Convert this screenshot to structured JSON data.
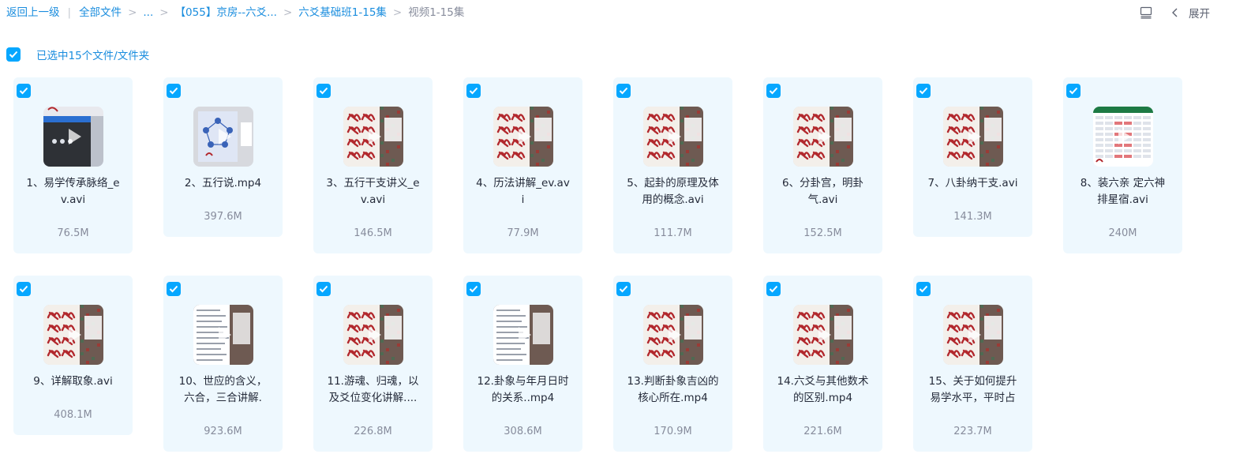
{
  "breadcrumb": {
    "back": "返回上一级",
    "root": "全部文件",
    "ellipsis": "...",
    "folder1": "【055】京房--六爻...",
    "folder2": "六爻基础班1-15集",
    "current": "视频1-15集"
  },
  "toolbar": {
    "expand_label": "展开"
  },
  "selection": {
    "text": "已选中15个文件/文件夹"
  },
  "colors": {
    "accent": "#06a7ff",
    "link": "#1a8dde",
    "card_bg": "#eef8fe"
  },
  "files": [
    {
      "name_lines": [
        "1、易学传承脉络_e",
        "v.avi"
      ],
      "size": "76.5M",
      "thumb": "player"
    },
    {
      "name_lines": [
        "2、五行说.mp4"
      ],
      "size": "397.6M",
      "thumb": "diagram"
    },
    {
      "name_lines": [
        "3、五行干支讲义_e",
        "v.avi"
      ],
      "size": "146.5M",
      "thumb": "calligraphy"
    },
    {
      "name_lines": [
        "4、历法讲解_ev.av",
        "i"
      ],
      "size": "77.9M",
      "thumb": "calligraphy"
    },
    {
      "name_lines": [
        "5、起卦的原理及体",
        "用的概念.avi"
      ],
      "size": "111.7M",
      "thumb": "calligraphy"
    },
    {
      "name_lines": [
        "6、分卦宫，明卦",
        "气.avi"
      ],
      "size": "152.5M",
      "thumb": "calligraphy"
    },
    {
      "name_lines": [
        "7、八卦纳干支.avi"
      ],
      "size": "141.3M",
      "thumb": "calligraphy"
    },
    {
      "name_lines": [
        "8、装六亲 定六神",
        "排星宿.avi"
      ],
      "size": "240M",
      "thumb": "spreadsheet"
    },
    {
      "name_lines": [
        "9、详解取象.avi"
      ],
      "size": "408.1M",
      "thumb": "calligraphy"
    },
    {
      "name_lines": [
        "10、世应的含义，",
        "六合，三合讲解."
      ],
      "size": "923.6M",
      "thumb": "document"
    },
    {
      "name_lines": [
        "11.游魂、归魂，以",
        "及爻位变化讲解...."
      ],
      "size": "226.8M",
      "thumb": "calligraphy"
    },
    {
      "name_lines": [
        "12.卦象与年月日时",
        "的关系..mp4"
      ],
      "size": "308.6M",
      "thumb": "document"
    },
    {
      "name_lines": [
        "13.判断卦象吉凶的",
        "核心所在.mp4"
      ],
      "size": "170.9M",
      "thumb": "calligraphy"
    },
    {
      "name_lines": [
        "14.六爻与其他数术",
        "的区别.mp4"
      ],
      "size": "221.6M",
      "thumb": "calligraphy"
    },
    {
      "name_lines": [
        "15、关于如何提升",
        "易学水平，平时占"
      ],
      "size": "223.7M",
      "thumb": "calligraphy"
    }
  ]
}
